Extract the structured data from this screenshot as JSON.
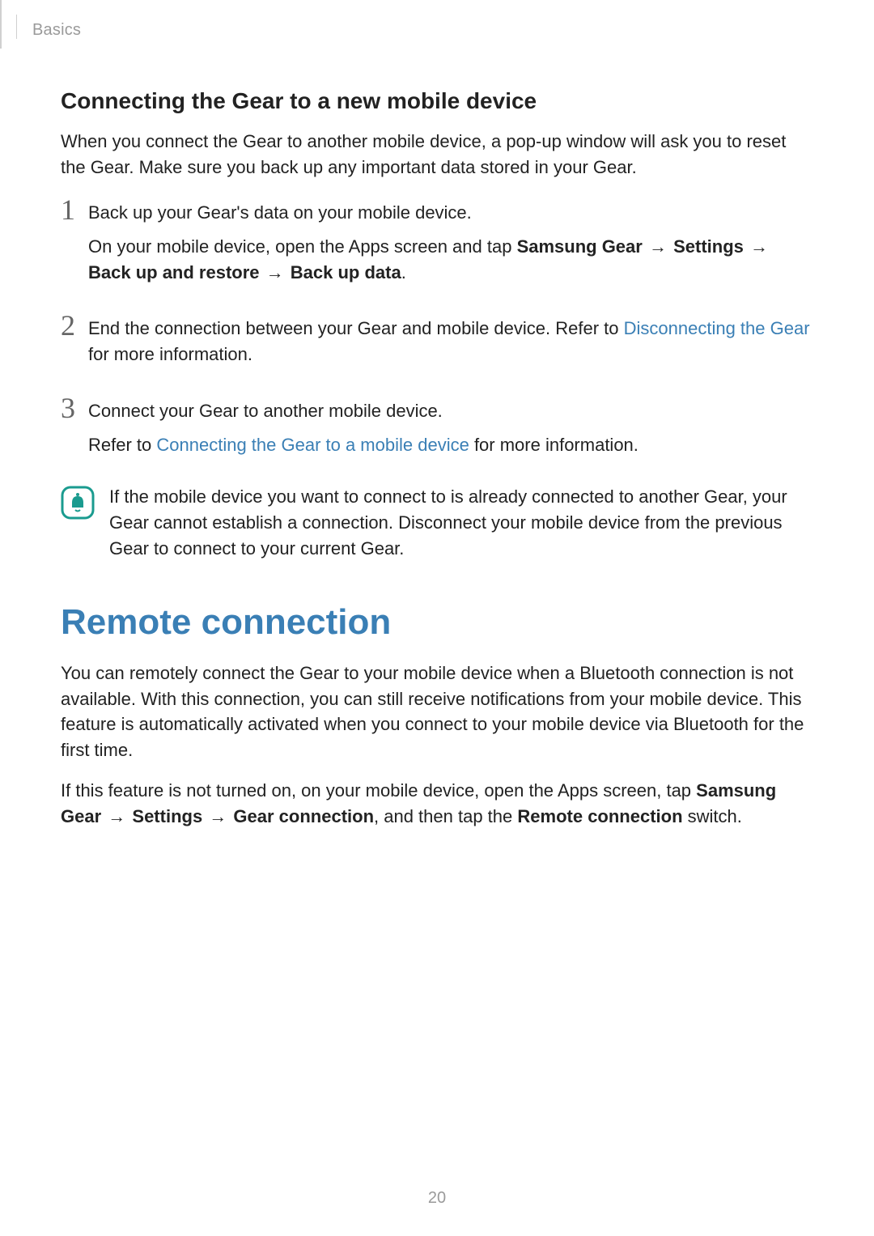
{
  "header": {
    "section": "Basics"
  },
  "section1": {
    "title": "Connecting the Gear to a new mobile device",
    "intro": "When you connect the Gear to another mobile device, a pop-up window will ask you to reset the Gear. Make sure you back up any important data stored in your Gear.",
    "steps": [
      {
        "num": "1",
        "line1": "Back up your Gear's data on your mobile device.",
        "line2_a": "On your mobile device, open the Apps screen and tap ",
        "line2_b1": "Samsung Gear",
        "line2_arrow": " → ",
        "line2_b2": "Settings",
        "line2_b3": "Back up and restore",
        "line2_b4": "Back up data",
        "line2_end": "."
      },
      {
        "num": "2",
        "text_a": "End the connection between your Gear and mobile device. Refer to ",
        "link": "Disconnecting the Gear",
        "text_b": " for more information."
      },
      {
        "num": "3",
        "line1": "Connect your Gear to another mobile device.",
        "line2_a": "Refer to ",
        "link": "Connecting the Gear to a mobile device",
        "line2_b": " for more information."
      }
    ],
    "note": "If the mobile device you want to connect to is already connected to another Gear, your Gear cannot establish a connection. Disconnect your mobile device from the previous Gear to connect to your current Gear."
  },
  "section2": {
    "title": "Remote connection",
    "p1": "You can remotely connect the Gear to your mobile device when a Bluetooth connection is not available. With this connection, you can still receive notifications from your mobile device. This feature is automatically activated when you connect to your mobile device via Bluetooth for the first time.",
    "p2_a": "If this feature is not turned on, on your mobile device, open the Apps screen, tap ",
    "p2_b1": "Samsung Gear",
    "p2_arrow": " → ",
    "p2_b2": "Settings",
    "p2_b3": "Gear connection",
    "p2_mid": ", and then tap the ",
    "p2_b4": "Remote connection",
    "p2_end": " switch."
  },
  "page_number": "20"
}
